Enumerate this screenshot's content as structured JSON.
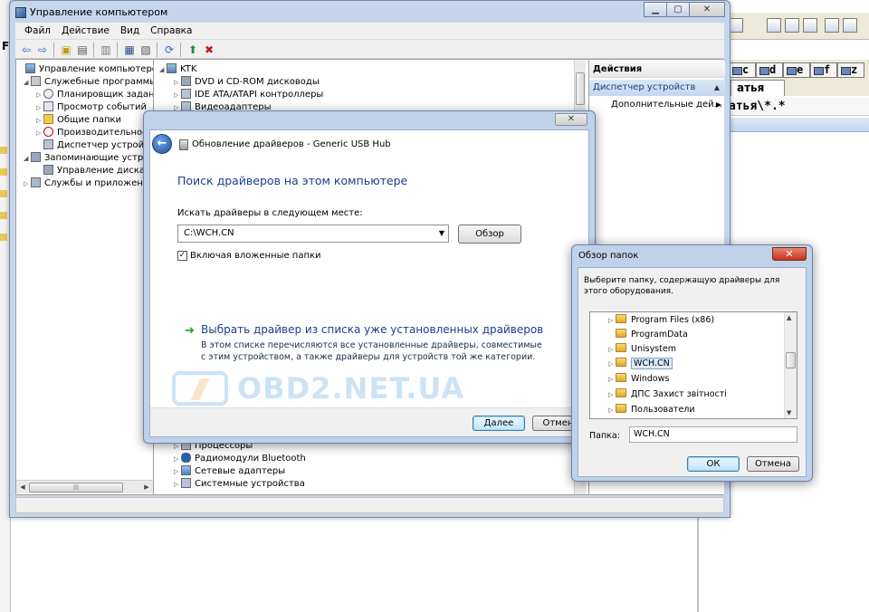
{
  "background_app": {
    "drives": [
      "c",
      "d",
      "e",
      "f",
      "z"
    ],
    "tab": "атья",
    "path": "атья\\*.*"
  },
  "left_strip": {
    "letter": "F"
  },
  "mmc": {
    "title": "Управление компьютером",
    "menu": [
      "Файл",
      "Действие",
      "Вид",
      "Справка"
    ],
    "left_tree": [
      {
        "label": "Управление компьютером (л",
        "icon": "computer-icon",
        "indent": 0,
        "arrow": ""
      },
      {
        "label": "Служебные программы",
        "icon": "tools-icon",
        "indent": 1,
        "arrow": "◢"
      },
      {
        "label": "Планировщик заданий",
        "icon": "clock-icon",
        "indent": 2,
        "arrow": "▷"
      },
      {
        "label": "Просмотр событий",
        "icon": "event-log-icon",
        "indent": 2,
        "arrow": "▷"
      },
      {
        "label": "Общие папки",
        "icon": "folder-icon",
        "indent": 2,
        "arrow": "▷"
      },
      {
        "label": "Производительность",
        "icon": "performance-icon",
        "indent": 2,
        "arrow": "▷"
      },
      {
        "label": "Диспетчер устройств",
        "icon": "device-manager-icon",
        "indent": 2,
        "arrow": ""
      },
      {
        "label": "Запоминающие устройст",
        "icon": "storage-icon",
        "indent": 1,
        "arrow": "◢"
      },
      {
        "label": "Управление дисками",
        "icon": "disk-icon",
        "indent": 2,
        "arrow": ""
      },
      {
        "label": "Службы и приложения",
        "icon": "services-icon",
        "indent": 1,
        "arrow": "▷"
      }
    ],
    "center_tree_top": [
      {
        "label": "KTK",
        "icon": "computer-icon",
        "indent": 0,
        "arrow": "◢"
      },
      {
        "label": "DVD и CD-ROM дисководы",
        "icon": "dvd-icon",
        "indent": 1,
        "arrow": "▷"
      },
      {
        "label": "IDE ATA/ATAPI контроллеры",
        "icon": "ide-icon",
        "indent": 1,
        "arrow": "▷"
      },
      {
        "label": "Видеоадаптеры",
        "icon": "display-adapter-icon",
        "indent": 1,
        "arrow": "▷"
      }
    ],
    "center_tree_bottom": [
      {
        "label": "Процессоры",
        "icon": "cpu-icon",
        "arrow": "▷"
      },
      {
        "label": "Радиомодули Bluetooth",
        "icon": "bluetooth-icon",
        "arrow": "▷"
      },
      {
        "label": "Сетевые адаптеры",
        "icon": "network-adapter-icon",
        "arrow": "▷"
      },
      {
        "label": "Системные устройства",
        "icon": "system-devices-icon",
        "arrow": "▷"
      }
    ],
    "actions": {
      "header": "Действия",
      "section": "Диспетчер устройств",
      "item": "Дополнительные дей..."
    }
  },
  "wizard": {
    "title": "Обновление драйверов - Generic USB Hub",
    "heading": "Поиск драйверов на этом компьютере",
    "search_label": "Искать драйверы в следующем месте:",
    "path_value": "C:\\WCH.CN",
    "browse_button": "Обзор",
    "include_subfolders": "Включая вложенные папки",
    "include_subfolders_checked": true,
    "option_title": "Выбрать драйвер из списка уже установленных драйверов",
    "option_desc": "В этом списке перечисляются все установленные драйверы, совместимые с этим устройством, а также драйверы для устройств той же категории.",
    "next_button": "Далее",
    "cancel_button": "Отмена"
  },
  "watermark": {
    "text": "OBD2.NET.UA"
  },
  "browse_dialog": {
    "title": "Обзор папок",
    "description": "Выберите папку, содержащую драйверы для этого оборудования.",
    "folders": [
      "Program Files (x86)",
      "ProgramData",
      "Unisystem",
      "WCH.CN",
      "Windows",
      "ДПС Захист звітності",
      "Пользователи"
    ],
    "selected": "WCH.CN",
    "folder_label": "Папка:",
    "folder_value": "WCH.CN",
    "ok_button": "ОК",
    "cancel_button": "Отмена"
  }
}
